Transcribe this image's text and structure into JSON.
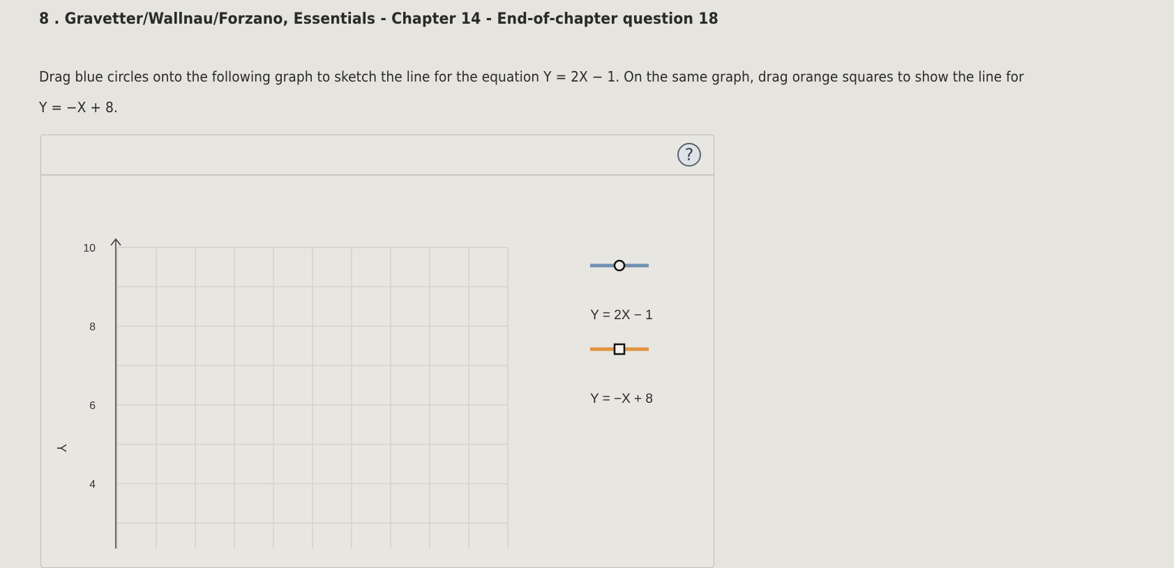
{
  "question": {
    "number": "8",
    "title": "8 . Gravetter/Wallnau/Forzano, Essentials - Chapter 14 - End-of-chapter question 18",
    "instructions_line1": "Drag blue circles onto the following graph to sketch the line for the equation Y = 2X − 1. On the same graph, drag orange squares to show the line for",
    "instructions_line2": "Y = −X + 8."
  },
  "panel": {
    "help_icon": "question-circle-icon",
    "help_label": "?"
  },
  "graph": {
    "y_axis_label": "Y",
    "y_ticks": [
      "10",
      "8",
      "6",
      "4"
    ],
    "y_range_visible": [
      3,
      10
    ],
    "grid_columns": 10,
    "gridline_step_y": 1
  },
  "legend": {
    "items": [
      {
        "label": "Y = 2X − 1",
        "tool": "blue-circle",
        "line_color": "#6f8fb0",
        "marker_shape": "circle"
      },
      {
        "label": "Y = −X + 8",
        "tool": "orange-square",
        "line_color": "#e0913f",
        "marker_shape": "square"
      }
    ]
  },
  "chart_data": {
    "type": "scatter",
    "title": "",
    "xlabel": "",
    "ylabel": "Y",
    "y_tick_labels": [
      "10",
      "8",
      "6",
      "4"
    ],
    "ylim": [
      3,
      10
    ],
    "grid": true,
    "series": [
      {
        "name": "Y = 2X − 1",
        "points": []
      },
      {
        "name": "Y = −X + 8",
        "points": []
      }
    ],
    "legend_position": "right"
  }
}
